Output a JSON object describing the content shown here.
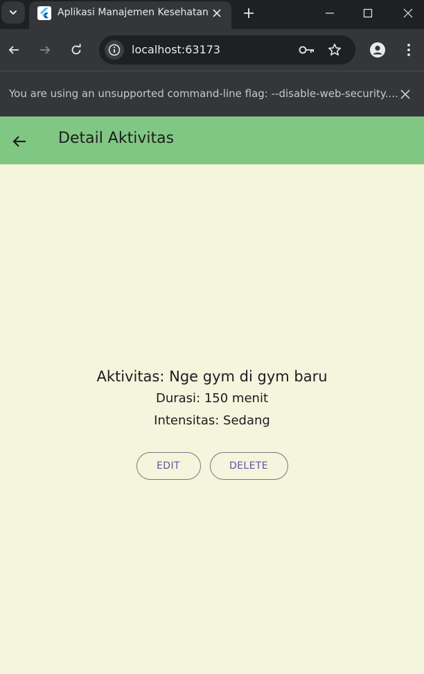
{
  "browser": {
    "tab_title": "Aplikasi Manajemen Kesehatan",
    "url": "localhost:63173",
    "infobar_message": "You are using an unsupported command-line flag: --disable-web-security...."
  },
  "app": {
    "title": "Detail Aktivitas",
    "activity_line": "Aktivitas: Nge gym di gym baru",
    "duration_line": "Durasi: 150 menit",
    "intensity_line": "Intensitas: Sedang",
    "edit_label": "EDIT",
    "delete_label": "DELETE"
  },
  "colors": {
    "appbar": "#81c784",
    "background": "#f5f4dc",
    "button_text": "#6750a4",
    "button_border": "#79747e"
  },
  "icons": {
    "tab_search": "chevron-down-icon",
    "favicon": "flutter-icon",
    "back": "arrow-left-icon",
    "key": "key-icon",
    "star": "star-icon",
    "profile": "profile-icon",
    "menu": "kebab-menu-icon"
  }
}
